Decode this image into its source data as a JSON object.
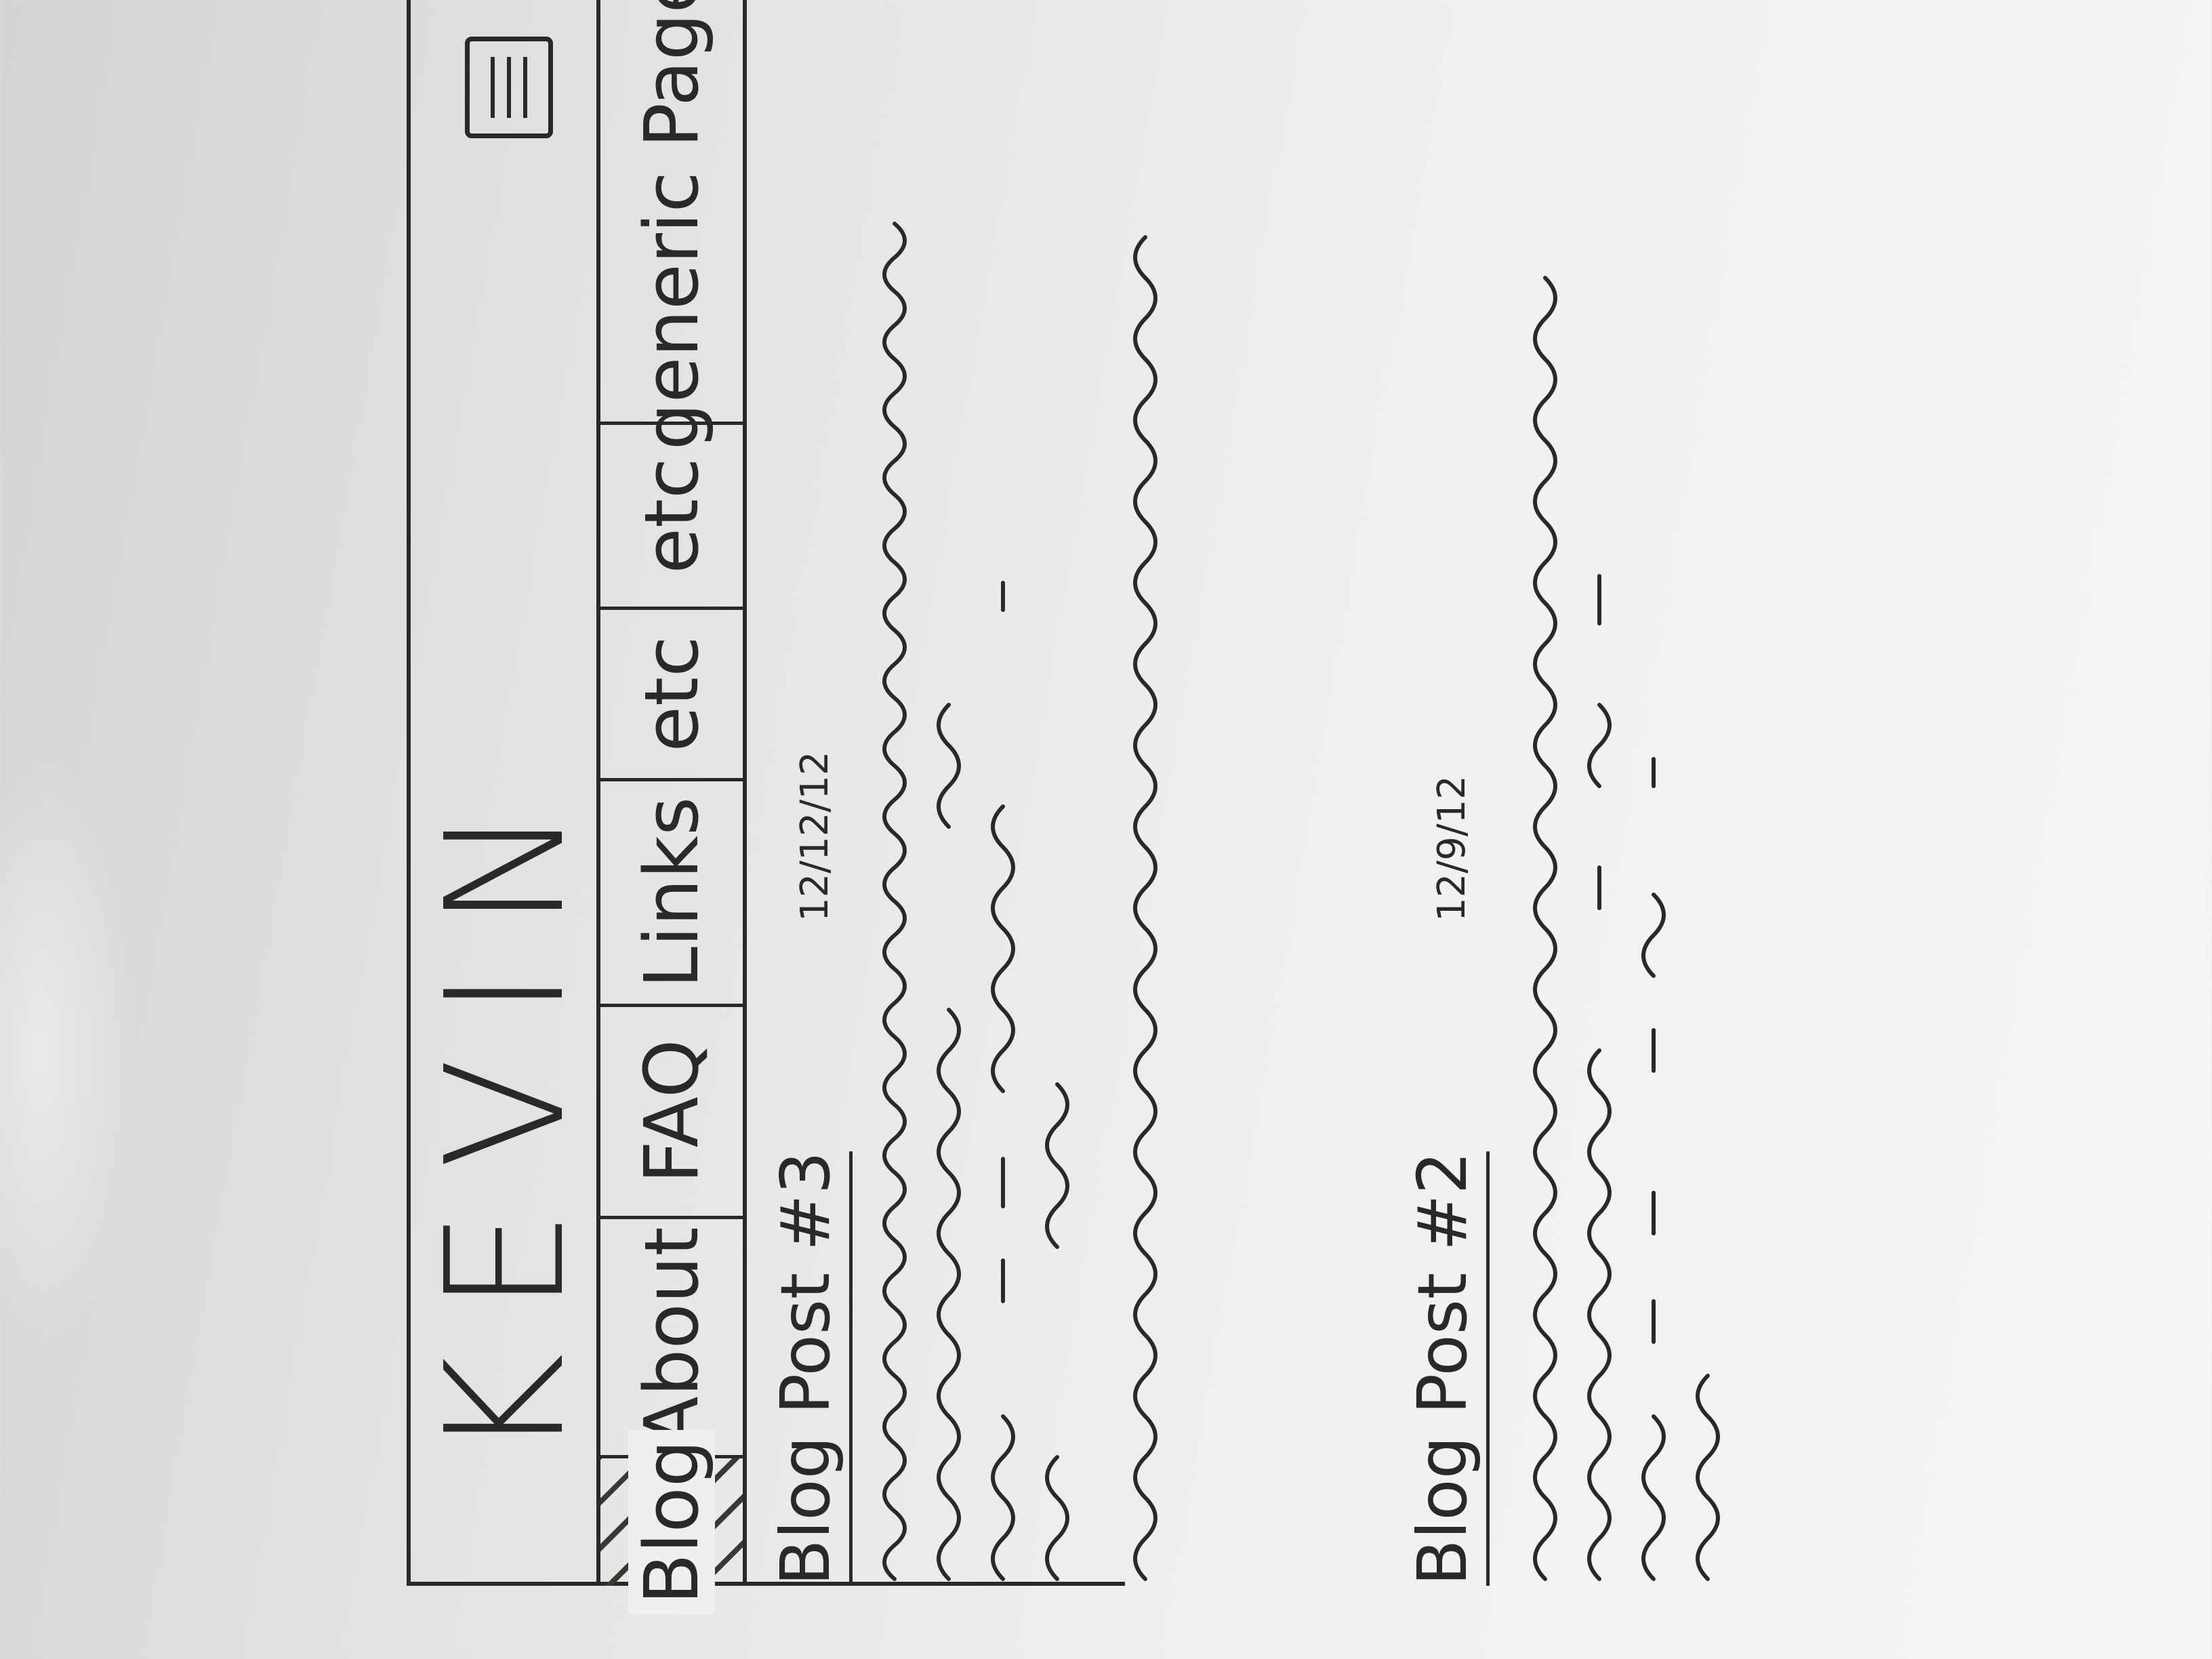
{
  "site": {
    "title": "KEVIN"
  },
  "header": {
    "menu_icon": "hamburger-menu-icon"
  },
  "nav": {
    "items": [
      {
        "label": "Blog",
        "active": true
      },
      {
        "label": "About"
      },
      {
        "label": "FAQ"
      },
      {
        "label": "Links"
      },
      {
        "label": "etc"
      },
      {
        "label": "etc"
      },
      {
        "label": "generic Page"
      }
    ]
  },
  "posts": [
    {
      "title": "Blog Post #3",
      "date": "12/12/12"
    },
    {
      "title": "Blog Post #2",
      "date": "12/9/12"
    }
  ]
}
